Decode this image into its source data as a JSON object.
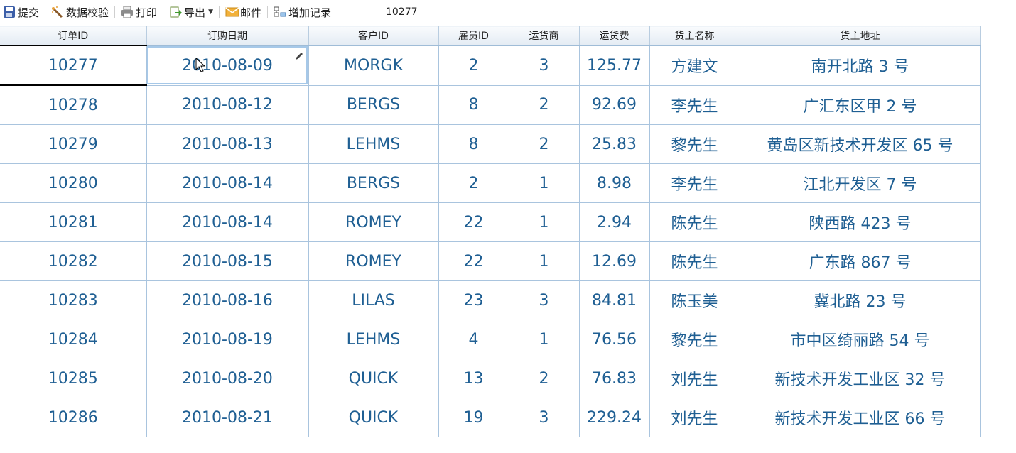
{
  "toolbar": {
    "submit": "提交",
    "validate": "数据校验",
    "print": "打印",
    "export": "导出",
    "mail": "邮件",
    "add_record": "增加记录",
    "current_cell": "10277"
  },
  "table": {
    "columns": [
      "订单ID",
      "订购日期",
      "客户ID",
      "雇员ID",
      "运货商",
      "运货费",
      "货主名称",
      "货主地址"
    ],
    "rows": [
      [
        "10277",
        "2010-08-09",
        "MORGK",
        "2",
        "3",
        "125.77",
        "方建文",
        "南开北路 3 号"
      ],
      [
        "10278",
        "2010-08-12",
        "BERGS",
        "8",
        "2",
        "92.69",
        "李先生",
        "广汇东区甲 2 号"
      ],
      [
        "10279",
        "2010-08-13",
        "LEHMS",
        "8",
        "2",
        "25.83",
        "黎先生",
        "黄岛区新技术开发区 65 号"
      ],
      [
        "10280",
        "2010-08-14",
        "BERGS",
        "2",
        "1",
        "8.98",
        "李先生",
        "江北开发区 7 号"
      ],
      [
        "10281",
        "2010-08-14",
        "ROMEY",
        "22",
        "1",
        "2.94",
        "陈先生",
        "陕西路 423 号"
      ],
      [
        "10282",
        "2010-08-15",
        "ROMEY",
        "22",
        "1",
        "12.69",
        "陈先生",
        "广东路 867 号"
      ],
      [
        "10283",
        "2010-08-16",
        "LILAS",
        "23",
        "3",
        "84.81",
        "陈玉美",
        "冀北路 23 号"
      ],
      [
        "10284",
        "2010-08-19",
        "LEHMS",
        "4",
        "1",
        "76.56",
        "黎先生",
        "市中区绮丽路 54 号"
      ],
      [
        "10285",
        "2010-08-20",
        "QUICK",
        "13",
        "2",
        "76.83",
        "刘先生",
        "新技术开发工业区 32 号"
      ],
      [
        "10286",
        "2010-08-21",
        "QUICK",
        "19",
        "3",
        "229.24",
        "刘先生",
        "新技术开发工业区 66 号"
      ]
    ]
  },
  "colors": {
    "cell_text": "#1f5f93",
    "grid_line": "#a9c4de"
  }
}
